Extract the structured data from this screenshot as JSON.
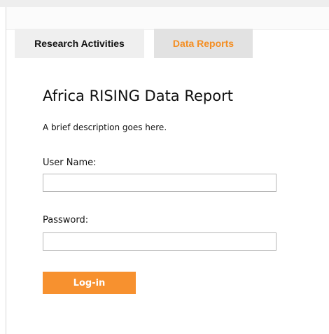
{
  "tabs": [
    {
      "label": "Research Activities",
      "active": false
    },
    {
      "label": "Data Reports",
      "active": true
    }
  ],
  "report": {
    "title": "Africa RISING Data Report",
    "description": "A brief description goes here."
  },
  "form": {
    "username_label": "User Name:",
    "username_value": "",
    "password_label": "Password:",
    "password_value": "",
    "login_label": "Log-in"
  },
  "colors": {
    "accent": "#f7912f",
    "active_tab_text": "#f48e22",
    "active_tab_bg": "#e2e2e2",
    "inactive_tab_bg": "#efefef"
  }
}
